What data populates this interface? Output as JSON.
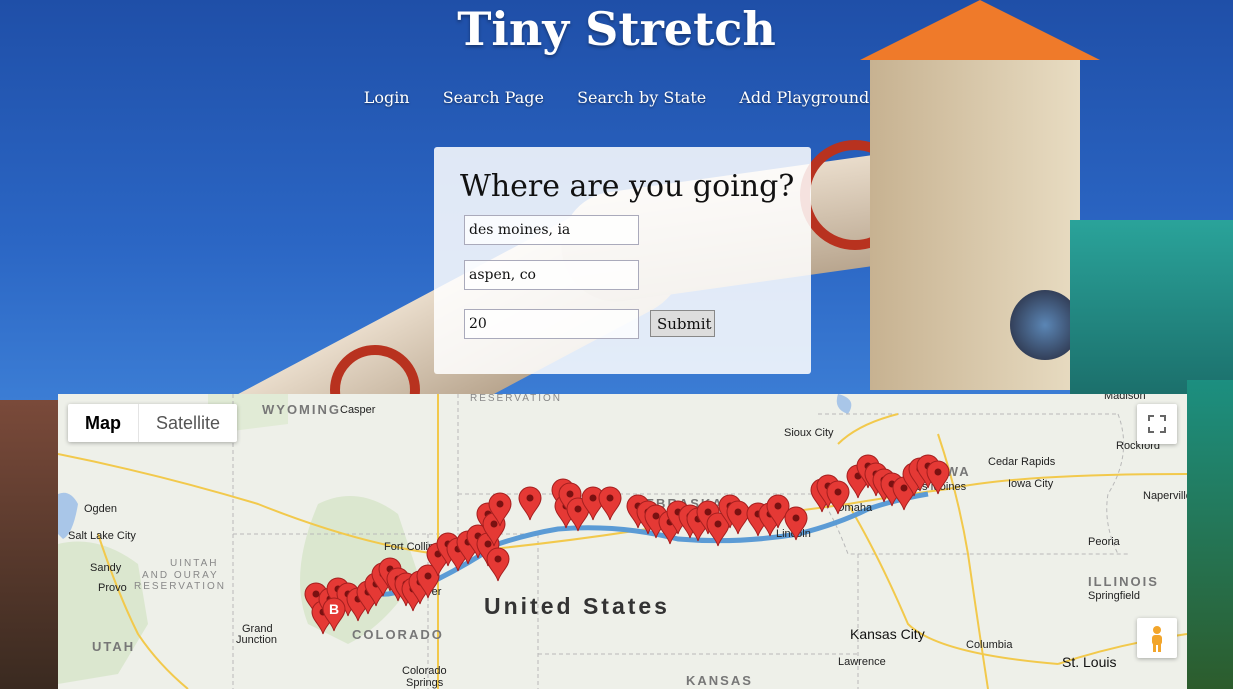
{
  "site": {
    "title": "Tiny Stretch"
  },
  "nav": {
    "items": [
      "Login",
      "Search Page",
      "Search by State",
      "Add Playground"
    ]
  },
  "form": {
    "heading": "Where are you going?",
    "origin_value": "des moines, ia",
    "destination_value": "aspen, co",
    "distance_value": "20",
    "submit_label": "Submit"
  },
  "map": {
    "map_type_map": "Map",
    "map_type_satellite": "Satellite",
    "route_color": "#5b9bd5",
    "marker_color": "#e53935",
    "end_marker_label": "B",
    "labels": {
      "wyoming": "WYOMING",
      "casper": "Casper",
      "reservation_top": "RESERVATION",
      "sioux_city": "Sioux City",
      "madison": "Madison",
      "rockford": "Rockford",
      "iowa": "IOWA",
      "cedar_rapids": "Cedar Rapids",
      "des_moines": "Des Moines",
      "iowa_city": "Iowa City",
      "naperville": "Naperville",
      "ogden": "Ogden",
      "salt_lake_city": "Salt Lake City",
      "sandy": "Sandy",
      "provo": "Provo",
      "uintah": "UINTAH",
      "and_ouray": "AND OURAY",
      "reservation": "RESERVATION",
      "fort_collins": "Fort Collins",
      "nebraska": "NEBRASKA",
      "omaha": "Omaha",
      "lincoln": "Lincoln",
      "united_states": "United States",
      "utah": "UTAH",
      "grand_junction_1": "Grand",
      "grand_junction_2": "Junction",
      "colorado": "COLORADO",
      "denver": "Denver",
      "peoria": "Peoria",
      "illinois": "ILLINOIS",
      "springfield": "Springfield",
      "kansas_city": "Kansas City",
      "columbia": "Columbia",
      "lawrence": "Lawrence",
      "st_louis": "St. Louis",
      "colorado_springs_1": "Colorado",
      "colorado_springs_2": "Springs",
      "kansas": "KANSAS"
    }
  }
}
